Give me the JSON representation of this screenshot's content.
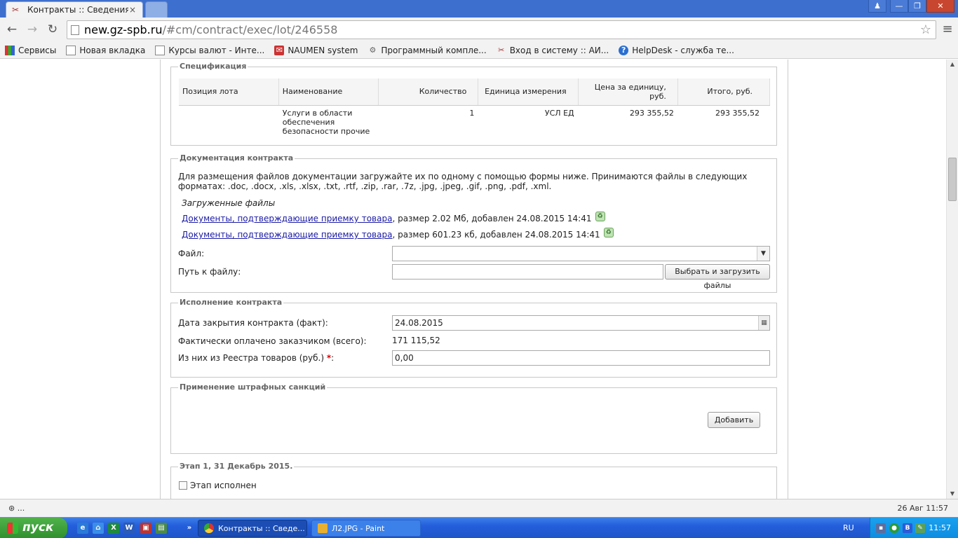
{
  "browser": {
    "tab_title": "Контракты :: Сведения об",
    "url_host": "new.gz-spb.ru",
    "url_path": "/#cm/contract/exec/lot/246558",
    "window_buttons": {
      "user": "♟",
      "minimize": "—",
      "restore": "❐",
      "close": "✕"
    },
    "nav": {
      "back": "←",
      "forward": "→",
      "reload": "↻",
      "star": "☆",
      "menu": "≡"
    },
    "bookmarks": [
      {
        "label": "Сервисы",
        "icon": "apps-icon"
      },
      {
        "label": "Новая вкладка",
        "icon": "page-icon"
      },
      {
        "label": "Курсы валют - Инте...",
        "icon": "page-icon"
      },
      {
        "label": "NAUMEN system",
        "icon": "naumen-icon"
      },
      {
        "label": "Программный компле...",
        "icon": "gear-icon"
      },
      {
        "label": "Вход в систему :: АИ...",
        "icon": "tool-icon"
      },
      {
        "label": "HelpDesk - служба те...",
        "icon": "help-icon"
      }
    ]
  },
  "spec": {
    "legend": "Спецификация",
    "headers": [
      "Позиция лота",
      "Наименование",
      "Количество",
      "Единица измерения",
      "Цена за единицу, руб.",
      "Итого, руб."
    ],
    "rows": [
      {
        "position": "",
        "name": "Услуги в области обеспечения безопасности прочие",
        "qty": "1",
        "unit": "УСЛ ЕД",
        "price": "293 355,52",
        "total": "293 355,52"
      }
    ]
  },
  "docs": {
    "legend": "Документация контракта",
    "description": "Для размещения файлов документации загружайте их по одному с помощью формы ниже. Принимаются файлы в следующих форматах: .doc, .docx, .xls, .xlsx, .txt, .rtf, .zip, .rar, .7z, .jpg, .jpeg, .gif, .png, .pdf, .xml.",
    "uploaded_title": "Загруженные файлы",
    "files": [
      {
        "link": "Документы, подтверждающие приемку товара",
        "info": ", размер 2.02 Мб, добавлен 24.08.2015 14:41"
      },
      {
        "link": "Документы, подтверждающие приемку товара",
        "info": ", размер 601.23 кб, добавлен 24.08.2015 14:41"
      }
    ],
    "file_label": "Файл:",
    "file_value": "",
    "path_label": "Путь к файлу:",
    "path_value": "",
    "upload_button": "Выбрать и загрузить файлы"
  },
  "execution": {
    "legend": "Исполнение контракта",
    "close_date_label": "Дата закрытия контракта (факт):",
    "close_date_value": "24.08.2015",
    "paid_label": "Фактически оплачено заказчиком (всего):",
    "paid_value": "171 115,52",
    "registry_label": "Из них из Реестра товаров (руб.)",
    "required_mark": "*",
    "colon": ":",
    "registry_value": "0,00"
  },
  "penalties": {
    "legend": "Применение штрафных санкций",
    "add_button": "Добавить"
  },
  "stage": {
    "legend": "Этап 1, 31 Декабрь 2015.",
    "done_label": "Этап исполнен"
  },
  "statusbar": {
    "left": "⊛ ...",
    "right": "26 Авг 11:57"
  },
  "taskbar": {
    "start": "пуск",
    "tasks": [
      "Контракты :: Сведе...",
      "Л2.JPG - Paint"
    ],
    "lang": "RU",
    "clock": "11:57"
  }
}
